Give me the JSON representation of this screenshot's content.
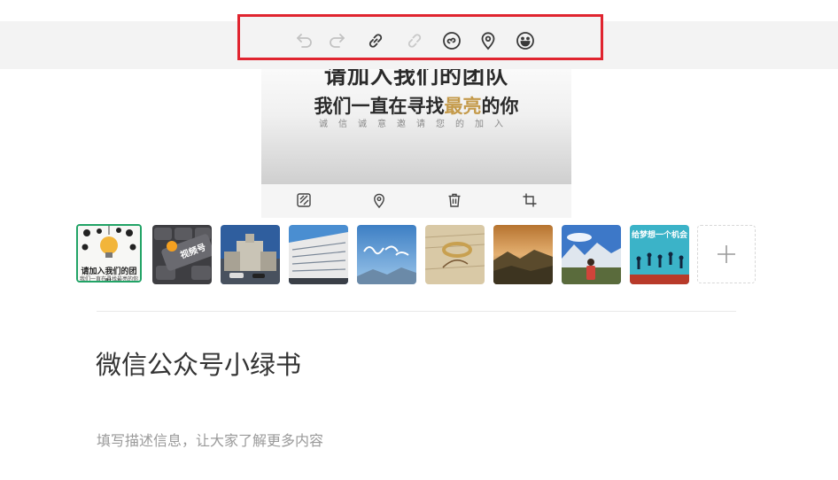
{
  "toolbar": {
    "tools": [
      {
        "name": "undo-icon",
        "enabled": false
      },
      {
        "name": "redo-icon",
        "enabled": false
      },
      {
        "name": "link-icon",
        "enabled": true
      },
      {
        "name": "unlink-icon",
        "enabled": false
      },
      {
        "name": "mini-program-icon",
        "enabled": true
      },
      {
        "name": "location-icon",
        "enabled": true
      },
      {
        "name": "emoji-icon",
        "enabled": true
      }
    ],
    "highlight_color": "#e0242f"
  },
  "preview": {
    "line1": "请加入我们的团队",
    "line2_prefix": "我们一直在寻找",
    "line2_accent": "最亮",
    "line2_suffix": "的你",
    "line3": "诚信诚意邀请您的加入",
    "accent_color": "#c49a4a"
  },
  "image_actions": [
    {
      "name": "replace-image-icon"
    },
    {
      "name": "location-icon"
    },
    {
      "name": "delete-icon"
    },
    {
      "name": "crop-icon"
    }
  ],
  "thumbnails": [
    {
      "name": "thumb-join-team",
      "selected": true,
      "caption": "请加入我们的团队",
      "caption2": "我们一直在寻找最亮的你"
    },
    {
      "name": "thumb-video-account",
      "selected": false,
      "caption": "视频号"
    },
    {
      "name": "thumb-building-classic",
      "selected": false
    },
    {
      "name": "thumb-building-office",
      "selected": false
    },
    {
      "name": "thumb-sky-calligraphy",
      "selected": false
    },
    {
      "name": "thumb-ring-paper",
      "selected": false
    },
    {
      "name": "thumb-sunset-landscape",
      "selected": false
    },
    {
      "name": "thumb-mountain-person",
      "selected": false
    },
    {
      "name": "thumb-dream-jump",
      "selected": false,
      "caption": "给梦想一个机会"
    }
  ],
  "add_image_label": "+",
  "title_value": "微信公众号小绿书",
  "description_placeholder": "填写描述信息，让大家了解更多内容",
  "selected_border_color": "#21a366"
}
